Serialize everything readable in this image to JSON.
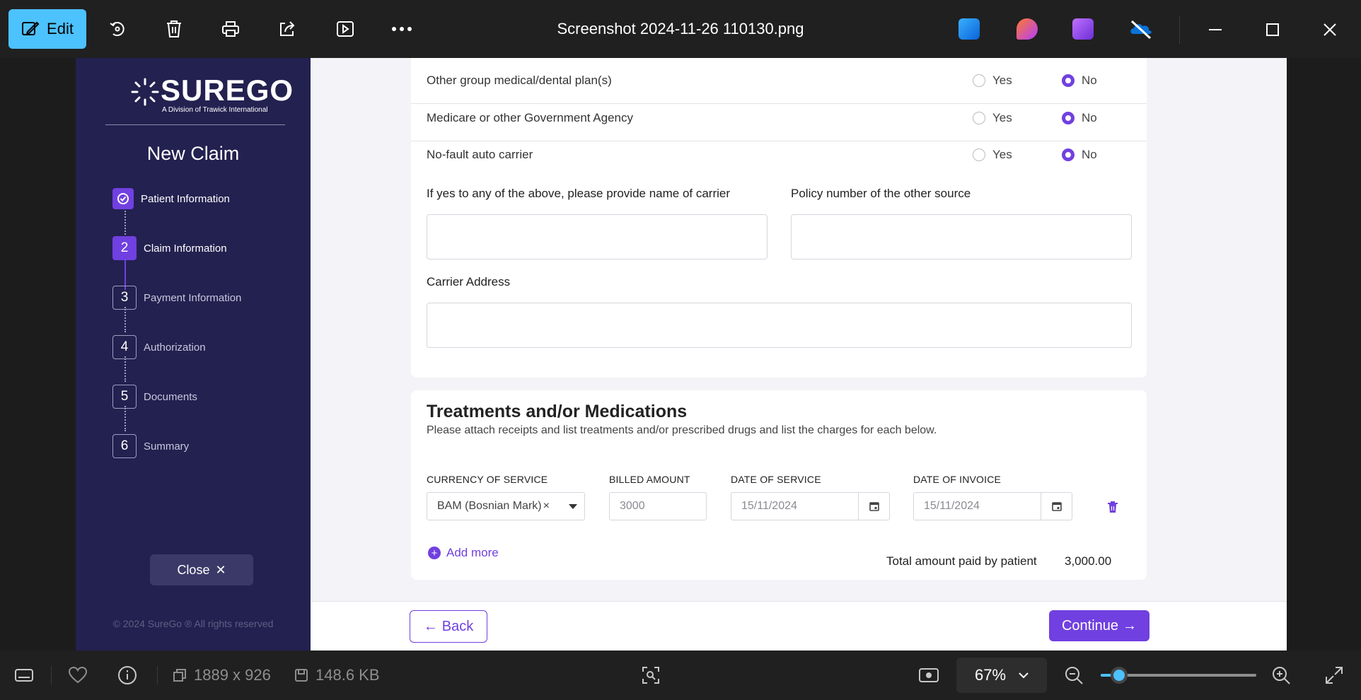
{
  "toolbar": {
    "edit_label": "Edit",
    "title": "Screenshot 2024-11-26 110130.png"
  },
  "sidebar": {
    "logo_text": "SUREGO",
    "logo_sub": "A Division of Trawick International",
    "heading": "New Claim",
    "steps": [
      {
        "num": "✓",
        "label": "Patient Information"
      },
      {
        "num": "2",
        "label": "Claim Information"
      },
      {
        "num": "3",
        "label": "Payment Information"
      },
      {
        "num": "4",
        "label": "Authorization"
      },
      {
        "num": "5",
        "label": "Documents"
      },
      {
        "num": "6",
        "label": "Summary"
      }
    ],
    "close_label": "Close",
    "close_symbol": "✕",
    "copyright": "© 2024 SureGo ® All rights reserved"
  },
  "other_coverage": {
    "questions": [
      {
        "label": "Other group medical/dental plan(s)",
        "yes": "Yes",
        "no": "No",
        "selected": "No"
      },
      {
        "label": "Medicare or other Government Agency",
        "yes": "Yes",
        "no": "No",
        "selected": "No"
      },
      {
        "label": "No-fault auto carrier",
        "yes": "Yes",
        "no": "No",
        "selected": "No"
      }
    ],
    "carrier_name_label": "If yes to any of the above, please provide name of carrier",
    "carrier_name_value": "",
    "policy_number_label": "Policy number of the other source",
    "policy_number_value": "",
    "carrier_address_label": "Carrier Address",
    "carrier_address_value": ""
  },
  "treatments": {
    "title": "Treatments and/or Medications",
    "description": "Please attach receipts and list treatments and/or prescribed drugs and list the charges for each below.",
    "columns": {
      "currency": "CURRENCY OF SERVICE",
      "billed": "BILLED AMOUNT",
      "date_service": "DATE OF SERVICE",
      "date_invoice": "DATE OF INVOICE"
    },
    "row": {
      "currency": "BAM (Bosnian Mark)",
      "clear": "×",
      "billed": "3000",
      "date_service": "15/11/2024",
      "date_invoice": "15/11/2024"
    },
    "add_more": "Add more",
    "total_label": "Total amount paid by patient",
    "total_value": "3,000.00"
  },
  "nav": {
    "back": "Back",
    "back_arrow": "←",
    "continue": "Continue",
    "continue_arrow": "→"
  },
  "statusbar": {
    "dimensions": "1889 x 926",
    "file_size": "148.6 KB",
    "zoom": "67%",
    "zoom_fraction": 0.12
  },
  "colors": {
    "accent": "#7140e0",
    "sidebar_bg": "#232150",
    "viewer_accent": "#4cc2ff"
  }
}
